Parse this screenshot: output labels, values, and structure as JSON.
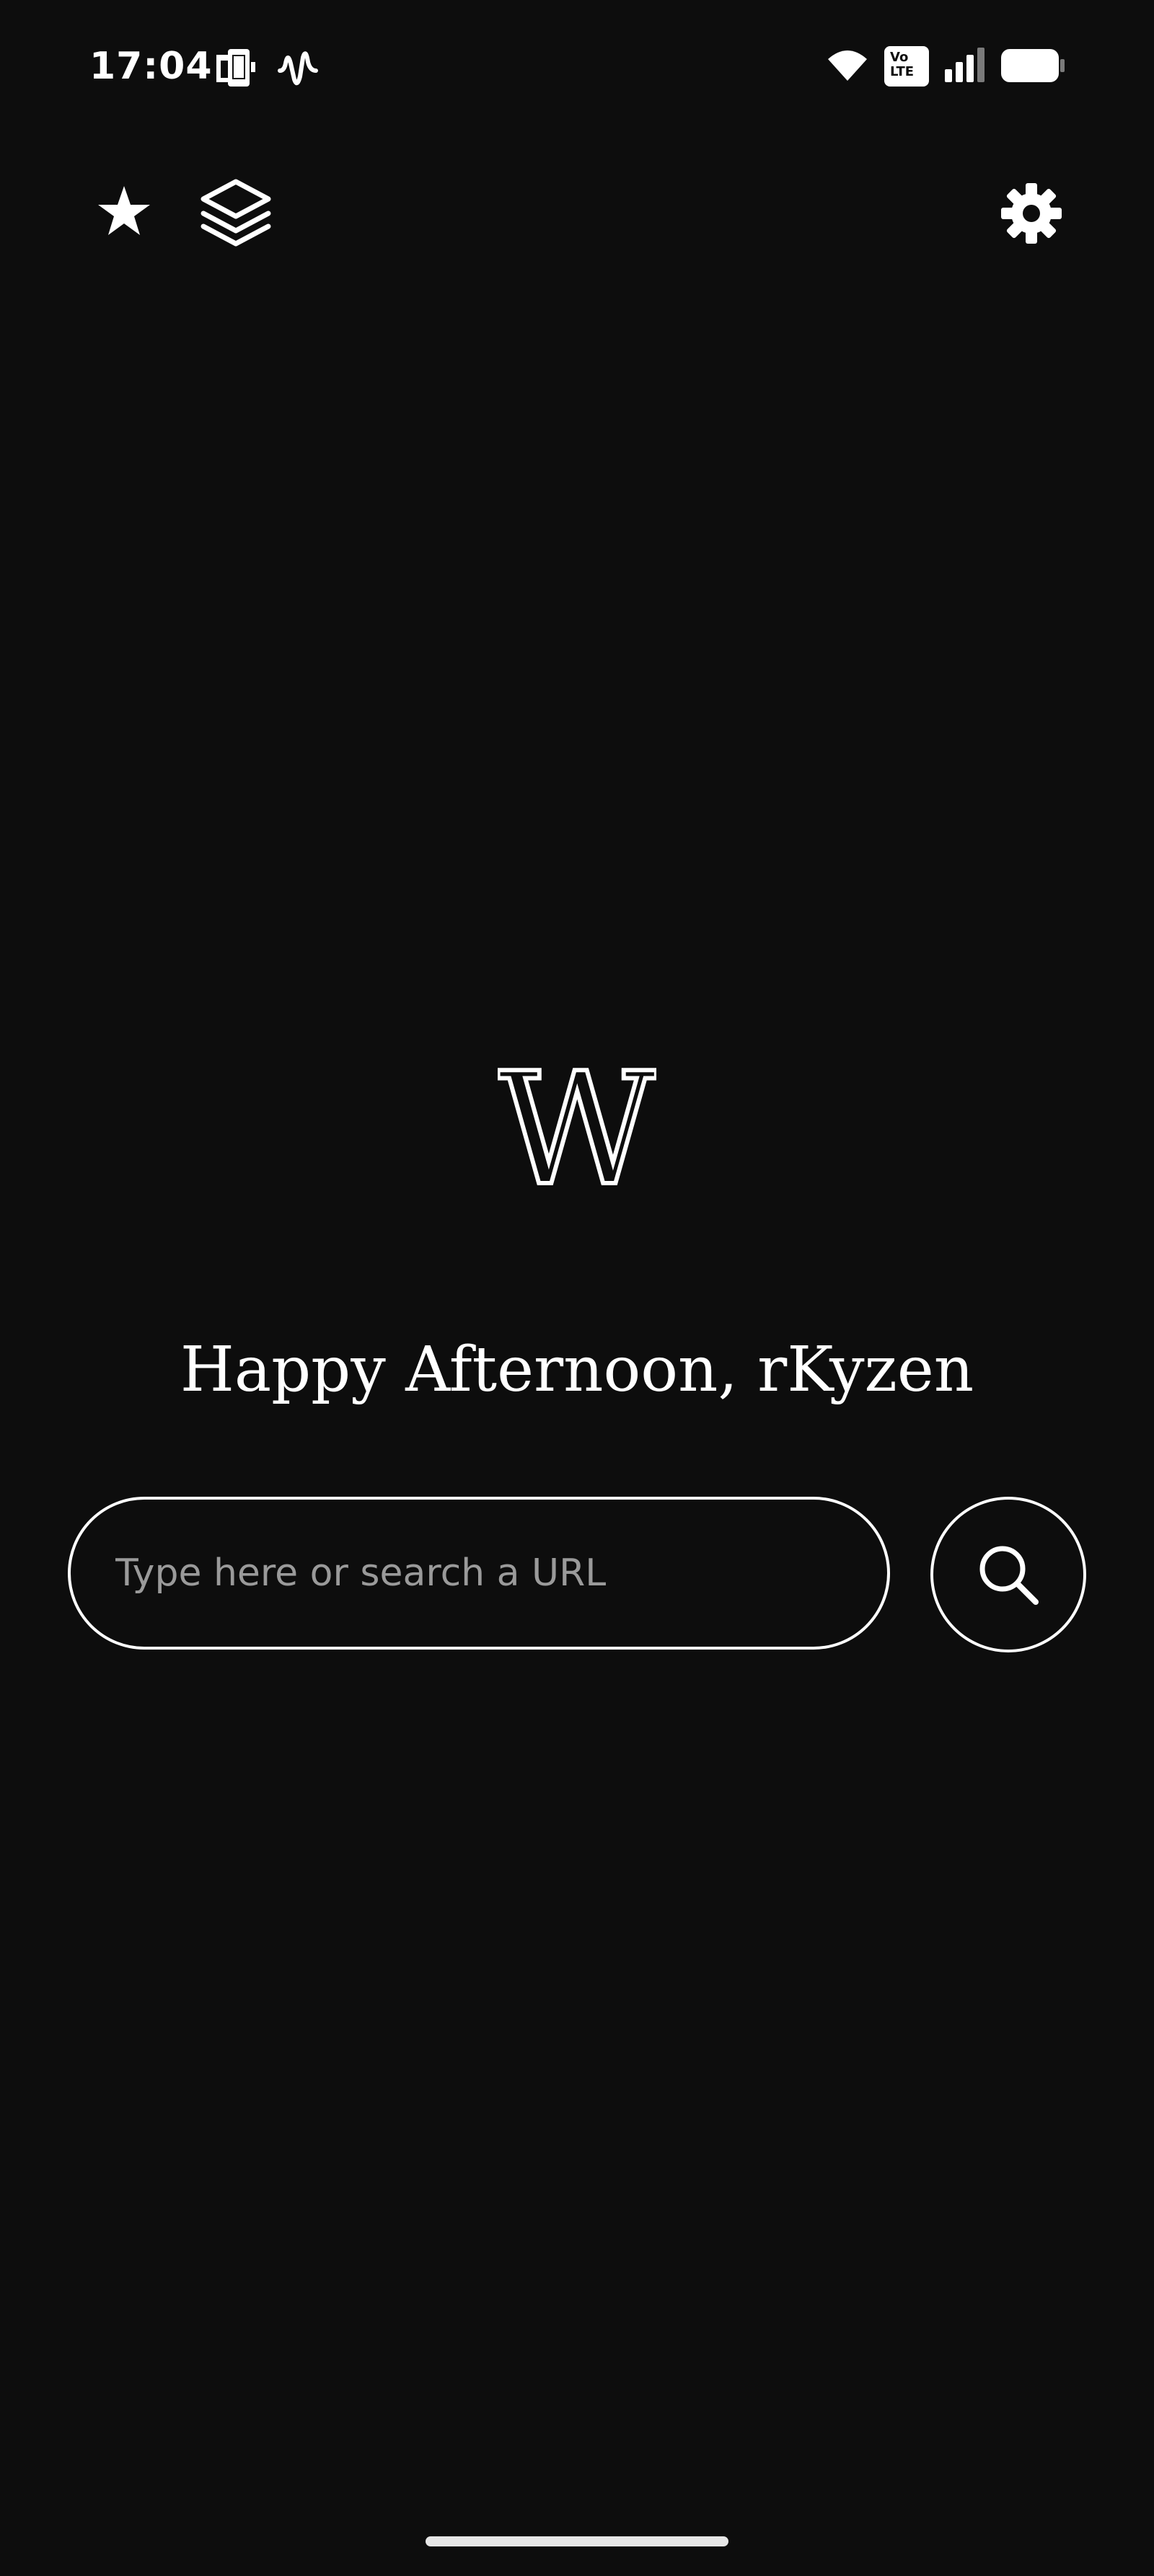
{
  "status_bar": {
    "time": "17:04",
    "icons": {
      "notification_1": "phone-screen-icon",
      "notification_2": "audio-wave-icon",
      "wifi": "wifi-icon",
      "volte": "volte-icon",
      "signal": "cellular-signal-icon",
      "battery": "battery-icon"
    },
    "volte_label_top": "Vo",
    "volte_label_bottom": "LTE"
  },
  "toolbar": {
    "bookmarks_icon": "star-icon",
    "tabs_icon": "layers-icon",
    "settings_icon": "gear-icon"
  },
  "home": {
    "logo_letter": "W",
    "greeting": "Happy Afternoon, rKyzen",
    "search": {
      "placeholder": "Type here or search a URL",
      "value": "",
      "button_icon": "search-icon"
    }
  },
  "colors": {
    "background": "#0d0d0d",
    "foreground": "#ffffff",
    "placeholder": "#9a9a9a"
  }
}
